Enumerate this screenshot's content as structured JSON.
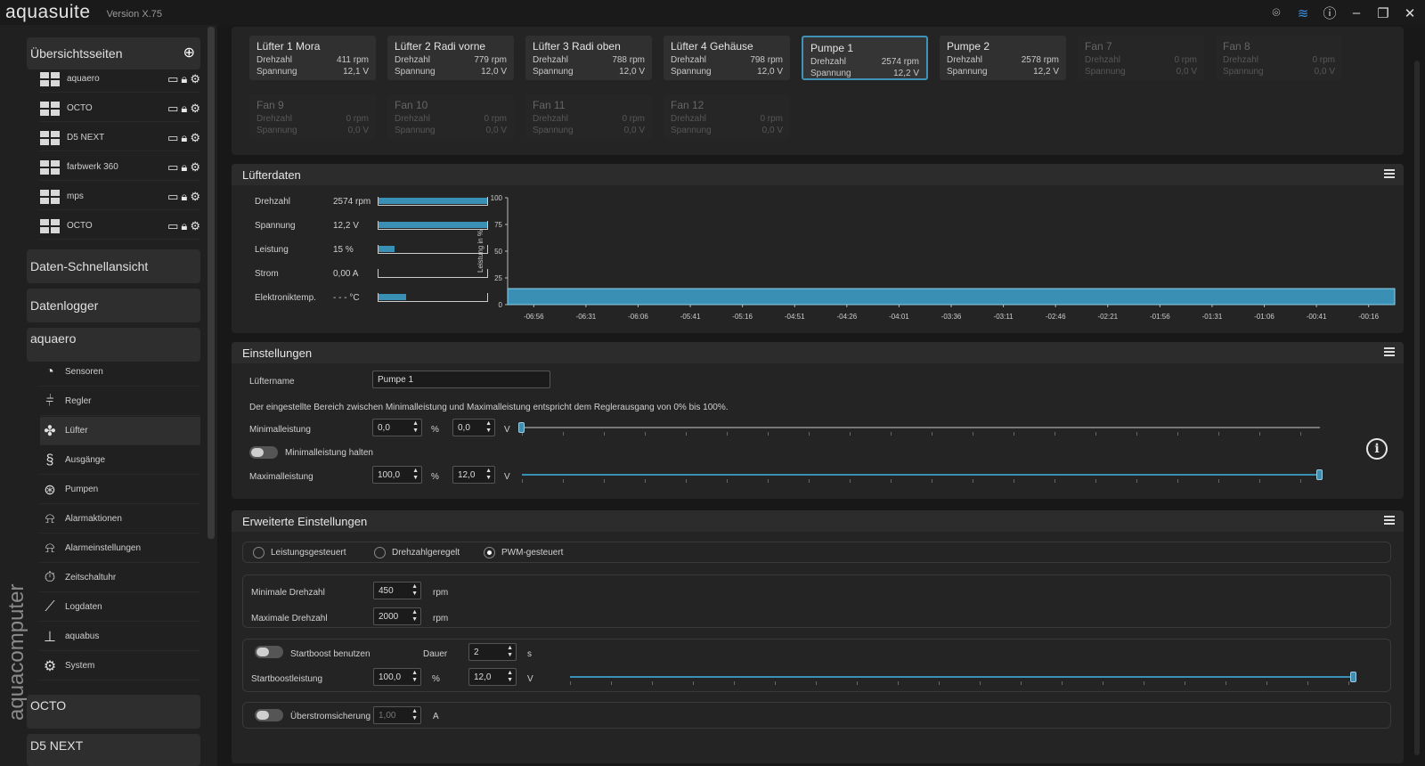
{
  "app": {
    "title": "aquasuite",
    "version": "Version X.75",
    "brand": "aquacomputer"
  },
  "sidebar": {
    "overview_header": "Übersichtsseiten",
    "overview_items": [
      "aquaero",
      "OCTO",
      "D5 NEXT",
      "farbwerk 360",
      "mps",
      "OCTO"
    ],
    "sections": [
      "Daten-Schnellansicht",
      "Datenlogger",
      "aquaero"
    ],
    "nav": [
      {
        "label": "Sensoren",
        "icon": "gauge-icon"
      },
      {
        "label": "Regler",
        "icon": "sliders-icon"
      },
      {
        "label": "Lüfter",
        "icon": "fan-icon"
      },
      {
        "label": "Ausgänge",
        "icon": "outputs-icon"
      },
      {
        "label": "Pumpen",
        "icon": "pump-icon"
      },
      {
        "label": "Alarmaktionen",
        "icon": "alarm-icon"
      },
      {
        "label": "Alarmeinstellungen",
        "icon": "alarm-settings-icon"
      },
      {
        "label": "Zeitschaltuhr",
        "icon": "timer-icon"
      },
      {
        "label": "Logdaten",
        "icon": "chart-icon"
      },
      {
        "label": "aquabus",
        "icon": "bus-icon"
      },
      {
        "label": "System",
        "icon": "gear-icon"
      }
    ],
    "bottom_sections": [
      "OCTO",
      "D5 NEXT"
    ]
  },
  "fans": [
    {
      "name": "Lüfter 1 Mora",
      "rpm_label": "Drehzahl",
      "rpm": "411 rpm",
      "volt_label": "Spannung",
      "volt": "12,1 V",
      "state": "on"
    },
    {
      "name": "Lüfter 2 Radi vorne",
      "rpm_label": "Drehzahl",
      "rpm": "779 rpm",
      "volt_label": "Spannung",
      "volt": "12,0 V",
      "state": "on"
    },
    {
      "name": "Lüfter 3 Radi oben",
      "rpm_label": "Drehzahl",
      "rpm": "788 rpm",
      "volt_label": "Spannung",
      "volt": "12,0 V",
      "state": "on"
    },
    {
      "name": "Lüfter 4 Gehäuse",
      "rpm_label": "Drehzahl",
      "rpm": "798 rpm",
      "volt_label": "Spannung",
      "volt": "12,0 V",
      "state": "on"
    },
    {
      "name": "Pumpe 1",
      "rpm_label": "Drehzahl",
      "rpm": "2574 rpm",
      "volt_label": "Spannung",
      "volt": "12,2 V",
      "state": "selected"
    },
    {
      "name": "Pumpe 2",
      "rpm_label": "Drehzahl",
      "rpm": "2578 rpm",
      "volt_label": "Spannung",
      "volt": "12,2 V",
      "state": "on"
    },
    {
      "name": "Fan 7",
      "rpm_label": "Drehzahl",
      "rpm": "0 rpm",
      "volt_label": "Spannung",
      "volt": "0,0 V",
      "state": "off"
    },
    {
      "name": "Fan 8",
      "rpm_label": "Drehzahl",
      "rpm": "0 rpm",
      "volt_label": "Spannung",
      "volt": "0,0 V",
      "state": "off"
    },
    {
      "name": "Fan 9",
      "rpm_label": "Drehzahl",
      "rpm": "0 rpm",
      "volt_label": "Spannung",
      "volt": "0,0 V",
      "state": "off"
    },
    {
      "name": "Fan 10",
      "rpm_label": "Drehzahl",
      "rpm": "0 rpm",
      "volt_label": "Spannung",
      "volt": "0,0 V",
      "state": "off"
    },
    {
      "name": "Fan 11",
      "rpm_label": "Drehzahl",
      "rpm": "0 rpm",
      "volt_label": "Spannung",
      "volt": "0,0 V",
      "state": "off"
    },
    {
      "name": "Fan 12",
      "rpm_label": "Drehzahl",
      "rpm": "0 rpm",
      "volt_label": "Spannung",
      "volt": "0,0 V",
      "state": "off"
    }
  ],
  "fandata": {
    "title": "Lüfterdaten",
    "rows": [
      {
        "label": "Drehzahl",
        "value": "2574 rpm",
        "fill": 1.0
      },
      {
        "label": "Spannung",
        "value": "12,2 V",
        "fill": 1.0
      },
      {
        "label": "Leistung",
        "value": "15 %",
        "fill": 0.15
      },
      {
        "label": "Strom",
        "value": "0,00 A",
        "fill": 0.0
      },
      {
        "label": "Elektroniktemp.",
        "value": "- - - °C",
        "fill": 0.25
      }
    ]
  },
  "chart_data": {
    "type": "area",
    "ylabel": "Leistung in %",
    "ylim": [
      0,
      100
    ],
    "yticks": [
      100,
      75,
      50,
      25,
      0
    ],
    "x": [
      "-06:56",
      "-06:31",
      "-06:06",
      "-05:41",
      "-05:16",
      "-04:51",
      "-04:26",
      "-04:01",
      "-03:36",
      "-03:11",
      "-02:46",
      "-02:21",
      "-01:56",
      "-01:31",
      "-01:06",
      "-00:41",
      "-00:16"
    ],
    "values": [
      15,
      15,
      15,
      15,
      15,
      15,
      15,
      15,
      15,
      15,
      15,
      15,
      15,
      15,
      15,
      15,
      15
    ],
    "color": "#3a8fb5"
  },
  "settings": {
    "title": "Einstellungen",
    "name_label": "Lüftername",
    "name_value": "Pumpe 1",
    "info": "Der eingestellte Bereich zwischen Minimalleistung und Maximalleistung entspricht dem Reglerausgang von 0% bis 100%.",
    "min_label": "Minimalleistung",
    "min_percent": "0,0",
    "min_volt": "0,0",
    "hold_label": "Minimalleistung halten",
    "max_label": "Maximalleistung",
    "max_percent": "100,0",
    "max_volt": "12,0",
    "unit_percent": "%",
    "unit_volt": "V",
    "min_level": 0.0,
    "max_level": 1.0
  },
  "advanced": {
    "title": "Erweiterte Einstellungen",
    "modes": [
      "Leistungsgesteuert",
      "Drehzahlgeregelt",
      "PWM-gesteuert"
    ],
    "selected_mode": "PWM-gesteuert",
    "min_rpm_label": "Minimale Drehzahl",
    "min_rpm": "450",
    "max_rpm_label": "Maximale Drehzahl",
    "max_rpm": "2000",
    "rpm_unit": "rpm",
    "startboost_label": "Startboost benutzen",
    "duration_label": "Dauer",
    "duration": "2",
    "duration_unit": "s",
    "boost_power_label": "Startboostleistung",
    "boost_percent": "100,0",
    "boost_volt": "12,0",
    "boost_level": 1.0,
    "overcurrent_label": "Überstromsicherung",
    "overcurrent": "1,00",
    "overcurrent_unit": "A"
  }
}
